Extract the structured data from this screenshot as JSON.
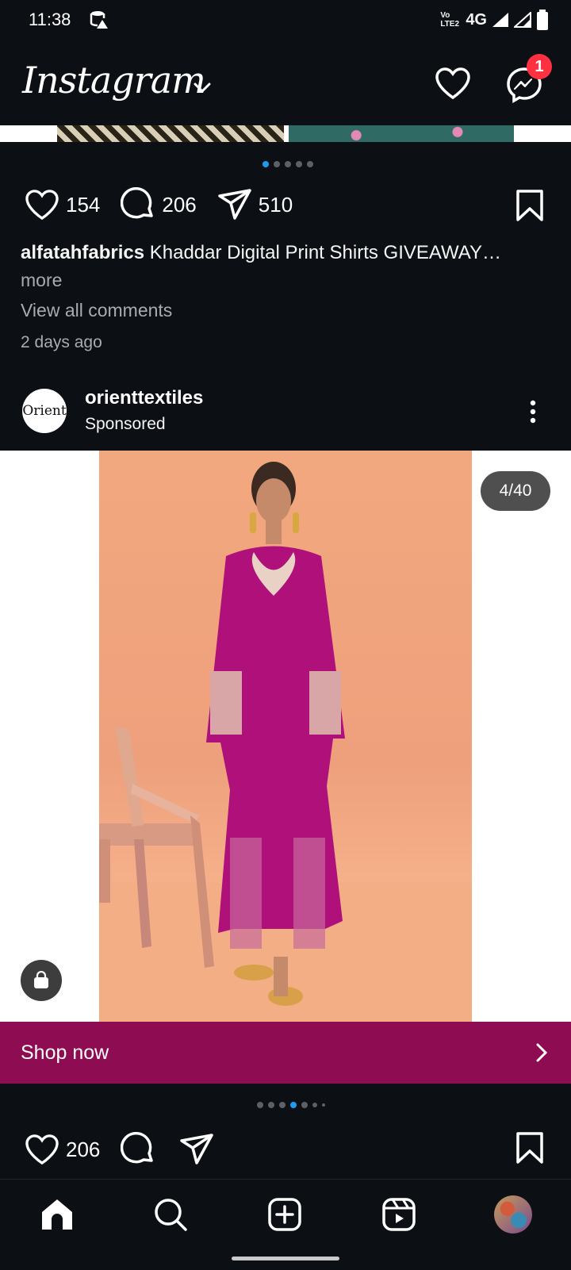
{
  "status_bar": {
    "time": "11:38",
    "network": "4G",
    "volte": "Vo LTE2"
  },
  "header": {
    "logo_text": "Instagram",
    "messages_badge": "1"
  },
  "previous_post": {
    "likes": "154",
    "comments": "206",
    "shares": "510",
    "username": "alfatahfabrics",
    "caption": "Khaddar Digital Print Shirts GIVEAWAY…",
    "more_label": "more",
    "view_comments": "View all comments",
    "time_ago": "2 days ago"
  },
  "post": {
    "username": "orienttextiles",
    "avatar_text": "Orient",
    "label": "Sponsored",
    "image_counter": "4/40",
    "cta_label": "Shop now",
    "cta_color": "#8e0c52",
    "likes": "206"
  },
  "icons": {
    "like": "heart-icon",
    "comment": "comment-icon",
    "share": "send-icon",
    "save": "bookmark-icon",
    "home": "home-icon",
    "search": "search-icon",
    "create": "create-icon",
    "reels": "reels-icon"
  },
  "colors": {
    "background": "#0c1014",
    "accent_blue": "#1d9bf0",
    "badge_red": "#ff3040"
  }
}
